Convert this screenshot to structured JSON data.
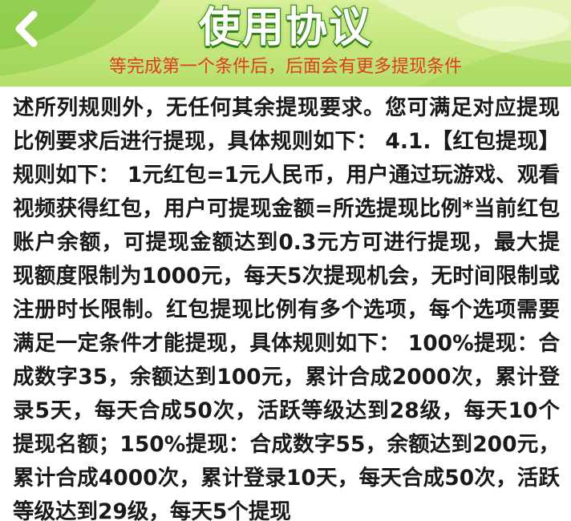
{
  "header": {
    "title": "使用协议",
    "subtitle": "等完成第一个条件后，后面会有更多提现条件",
    "back_icon": "chevron-left-icon",
    "colors": {
      "header_bg": "#c7e87f",
      "title_stroke": "#3f9a1e",
      "subtitle": "#e23a1c"
    }
  },
  "content": {
    "text": "述所列规则外，无任何其余提现要求。您可满足对应提现比例要求后进行提现，具体规则如下： 4.1.【红包提现】规则如下： 1元红包=1元人民币，用户通过玩游戏、观看视频获得红包，用户可提现金额=所选提现比例*当前红包账户余额，可提现金额达到0.3元方可进行提现，最大提现额度限制为1000元，每天5次提现机会，无时间限制或注册时长限制。红包提现比例有多个选项，每个选项需要满足一定条件才能提现，具体规则如下： 100%提现：合成数字35，余额达到100元，累计合成2000次，累计登录5天，每天合成50次，活跃等级达到28级，每天10个提现名额；150%提现：合成数字55，余额达到200元，累计合成4000次，累计登录10天，每天合成50次，活跃等级达到29级，每天5个提现"
  }
}
